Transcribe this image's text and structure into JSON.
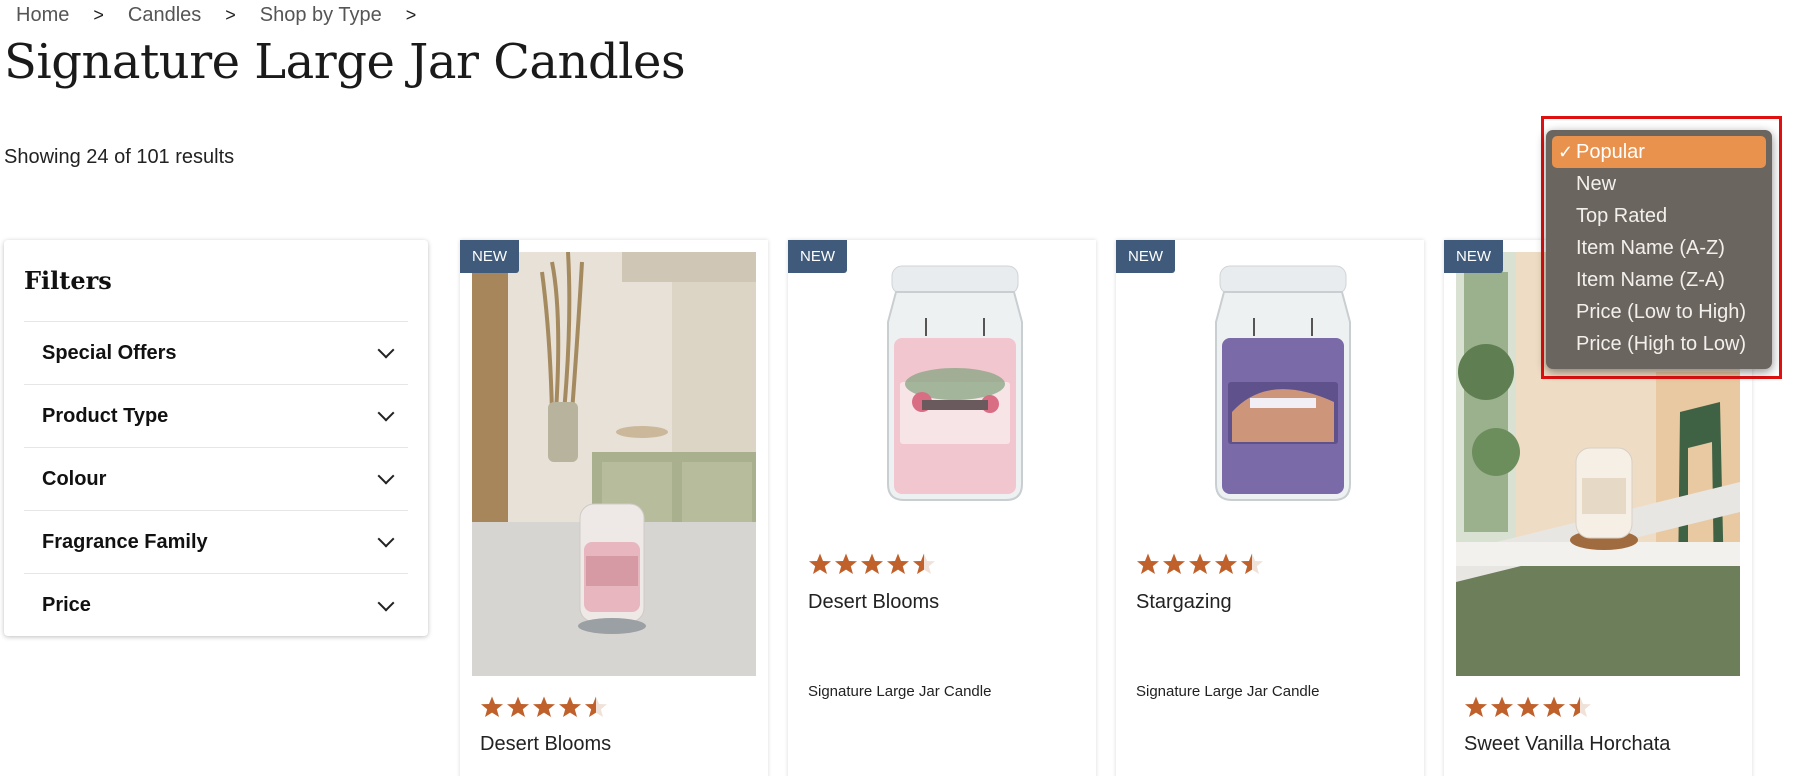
{
  "breadcrumb": [
    {
      "label": "Home"
    },
    {
      "label": "Candles"
    },
    {
      "label": "Shop by Type"
    }
  ],
  "breadcrumb_separator": ">",
  "page_title": "Signature Large Jar Candles",
  "results_text": "Showing 24 of 101 results",
  "filters": {
    "title": "Filters",
    "items": [
      {
        "label": "Special Offers"
      },
      {
        "label": "Product Type"
      },
      {
        "label": "Colour"
      },
      {
        "label": "Fragrance Family"
      },
      {
        "label": "Price"
      }
    ]
  },
  "products": [
    {
      "badge": "NEW",
      "name": "Desert Blooms",
      "type": "",
      "rating": 4.5,
      "image": "lifestyle-pink-candle"
    },
    {
      "badge": "NEW",
      "name": "Desert Blooms",
      "type": "Signature Large Jar Candle",
      "rating": 4.5,
      "image": "pink-jar-candle"
    },
    {
      "badge": "NEW",
      "name": "Stargazing",
      "type": "Signature Large Jar Candle",
      "rating": 4.5,
      "image": "purple-jar-candle"
    },
    {
      "badge": "NEW",
      "name": "Sweet Vanilla Horchata",
      "type": "",
      "rating": 4.5,
      "image": "lifestyle-cream-candle"
    }
  ],
  "sort": {
    "options": [
      {
        "label": "Popular",
        "selected": true
      },
      {
        "label": "New",
        "selected": false
      },
      {
        "label": "Top Rated",
        "selected": false
      },
      {
        "label": "Item Name (A-Z)",
        "selected": false
      },
      {
        "label": "Item Name (Z-A)",
        "selected": false
      },
      {
        "label": "Price (Low to High)",
        "selected": false
      },
      {
        "label": "Price (High to Low)",
        "selected": false
      }
    ],
    "check_mark": "✓"
  },
  "colors": {
    "badge": "#3f5a7a",
    "star": "#c0602b",
    "menu_bg": "#6b6560",
    "menu_selected": "#e8924d",
    "highlight_outline": "#e01010"
  }
}
